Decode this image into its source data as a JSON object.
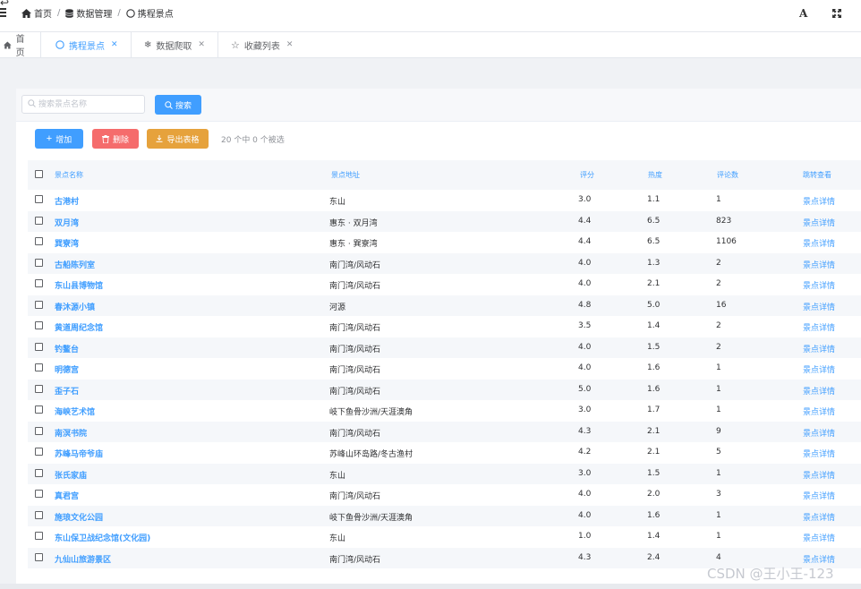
{
  "breadcrumb": [
    {
      "label": "首页",
      "icon": "home-icon"
    },
    {
      "label": "数据管理",
      "icon": "database-icon"
    },
    {
      "label": "携程景点",
      "icon": "circle-icon"
    }
  ],
  "topbar": {
    "font_icon_label": "A",
    "fullscreen_icon": "fullscreen-icon"
  },
  "tabs": [
    {
      "label": "首页",
      "icon": "home-icon",
      "active": false,
      "closable": false
    },
    {
      "label": "携程景点",
      "icon": "circle-icon",
      "active": true,
      "closable": true
    },
    {
      "label": "数据爬取",
      "icon": "snowflake-icon",
      "active": false,
      "closable": true
    },
    {
      "label": "收藏列表",
      "icon": "star-icon",
      "active": false,
      "closable": true
    }
  ],
  "search": {
    "placeholder": "搜索景点名称",
    "value": "",
    "button_label": "搜索"
  },
  "toolbar": {
    "add_label": "增加",
    "delete_label": "删除",
    "export_label": "导出表格",
    "selection_info": "20 个中 0 个被选"
  },
  "table": {
    "columns": [
      "景点名称",
      "景点地址",
      "评分",
      "热度",
      "评论数",
      "跳转查看"
    ],
    "rows": [
      {
        "name": "古港村",
        "address": "东山",
        "score": "3.0",
        "heat": "1.1",
        "comments": "1",
        "link": "景点详情"
      },
      {
        "name": "双月湾",
        "address": "惠东 · 双月湾",
        "score": "4.4",
        "heat": "6.5",
        "comments": "823",
        "link": "景点详情"
      },
      {
        "name": "巽寮湾",
        "address": "惠东 · 巽寮湾",
        "score": "4.4",
        "heat": "6.5",
        "comments": "1106",
        "link": "景点详情"
      },
      {
        "name": "古船陈列室",
        "address": "南门湾/风动石",
        "score": "4.0",
        "heat": "1.3",
        "comments": "2",
        "link": "景点详情"
      },
      {
        "name": "东山县博物馆",
        "address": "南门湾/风动石",
        "score": "4.0",
        "heat": "2.1",
        "comments": "2",
        "link": "景点详情"
      },
      {
        "name": "春沐源小镇",
        "address": "河源",
        "score": "4.8",
        "heat": "5.0",
        "comments": "16",
        "link": "景点详情"
      },
      {
        "name": "黄道周纪念馆",
        "address": "南门湾/风动石",
        "score": "3.5",
        "heat": "1.4",
        "comments": "2",
        "link": "景点详情"
      },
      {
        "name": "钓鳌台",
        "address": "南门湾/风动石",
        "score": "4.0",
        "heat": "1.5",
        "comments": "2",
        "link": "景点详情"
      },
      {
        "name": "明德宫",
        "address": "南门湾/风动石",
        "score": "4.0",
        "heat": "1.6",
        "comments": "1",
        "link": "景点详情"
      },
      {
        "name": "歪子石",
        "address": "南门湾/风动石",
        "score": "5.0",
        "heat": "1.6",
        "comments": "1",
        "link": "景点详情"
      },
      {
        "name": "海峡艺术馆",
        "address": "岐下鱼骨沙洲/天涯澳角",
        "score": "3.0",
        "heat": "1.7",
        "comments": "1",
        "link": "景点详情"
      },
      {
        "name": "南溟书院",
        "address": "南门湾/风动石",
        "score": "4.3",
        "heat": "2.1",
        "comments": "9",
        "link": "景点详情"
      },
      {
        "name": "苏峰马帝爷庙",
        "address": "苏峰山环岛路/冬古渔村",
        "score": "4.2",
        "heat": "2.1",
        "comments": "5",
        "link": "景点详情"
      },
      {
        "name": "张氏家庙",
        "address": "东山",
        "score": "3.0",
        "heat": "1.5",
        "comments": "1",
        "link": "景点详情"
      },
      {
        "name": "真君宫",
        "address": "南门湾/风动石",
        "score": "4.0",
        "heat": "2.0",
        "comments": "3",
        "link": "景点详情"
      },
      {
        "name": "施琅文化公园",
        "address": "岐下鱼骨沙洲/天涯澳角",
        "score": "4.0",
        "heat": "1.6",
        "comments": "1",
        "link": "景点详情"
      },
      {
        "name": "东山保卫战纪念馆(文化园)",
        "address": "东山",
        "score": "1.0",
        "heat": "1.4",
        "comments": "1",
        "link": "景点详情"
      },
      {
        "name": "九仙山旅游景区",
        "address": "南门湾/风动石",
        "score": "4.3",
        "heat": "2.4",
        "comments": "4",
        "link": "景点详情"
      }
    ]
  },
  "watermark": "CSDN @王小王-123",
  "colors": {
    "primary": "#409eff",
    "danger": "#f56c6c",
    "warning": "#e6a23c"
  }
}
